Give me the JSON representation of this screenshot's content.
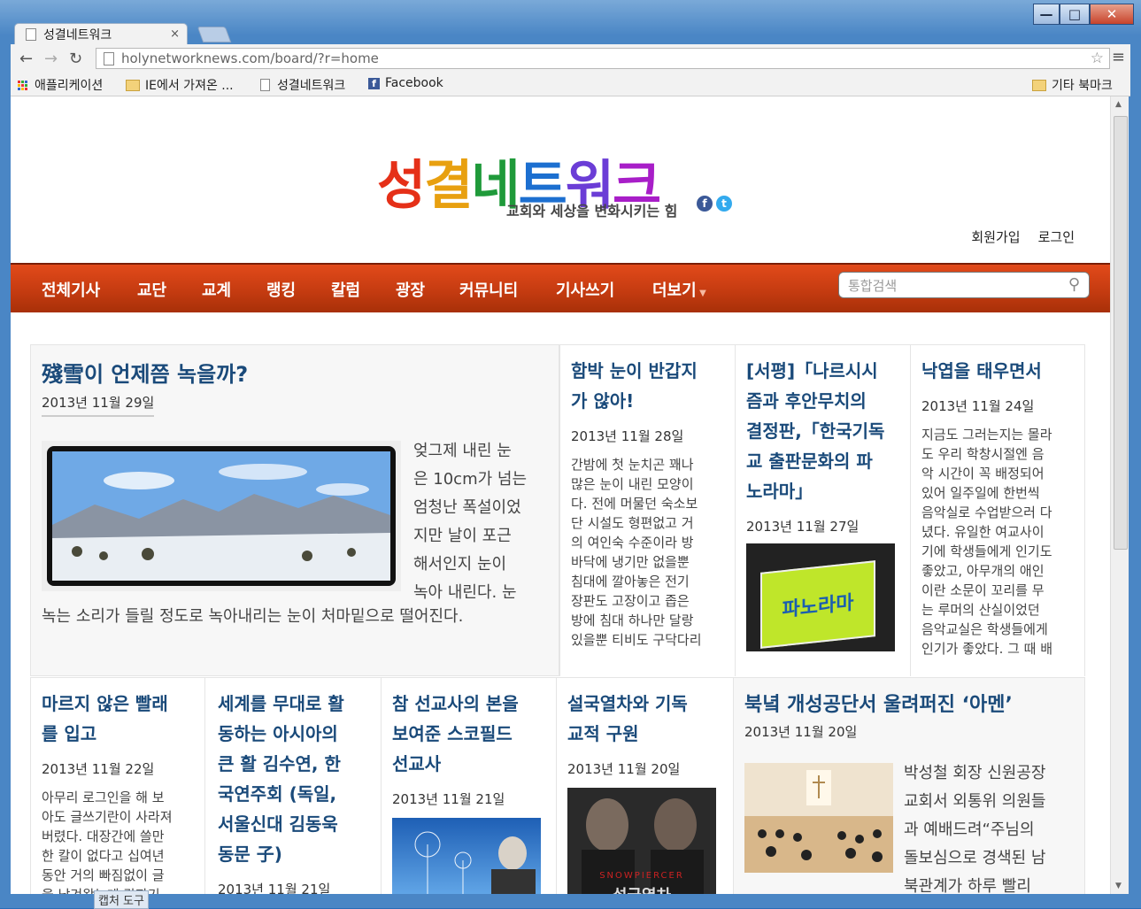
{
  "browser": {
    "tab_title": "성결네트워크",
    "tab_close": "×",
    "url": "holynetworknews.com/board/?r=home",
    "bookmarks": [
      "애플리케이션",
      "IE에서 가져온 ...",
      "성결네트워크",
      "Facebook"
    ],
    "other_bookmarks": "기타 북마크",
    "window_controls": {
      "minimize": "—",
      "maximize": "□",
      "close": "✕"
    }
  },
  "site": {
    "logo_chars": [
      "성",
      "결",
      "네",
      "트",
      "워",
      "크"
    ],
    "tagline": "교회와 세상을 변화시키는 힘",
    "top_links": [
      "회원가입",
      "로그인"
    ],
    "nav": [
      "전체기사",
      "교단",
      "교계",
      "랭킹",
      "칼럼",
      "광장",
      "커뮤니티",
      "기사쓰기",
      "더보기"
    ],
    "search_placeholder": "통합검색"
  },
  "colors": {
    "nav_bg": "#c23a10",
    "title_blue": "#1a4a7a",
    "logo": [
      "#e53018",
      "#e8a010",
      "#1f9a3a",
      "#1c6fd0",
      "#6b3dd6",
      "#a81ec8"
    ]
  },
  "articles": {
    "featured": {
      "title": "殘雪이 언제쯤 녹을까?",
      "date": "2013년 11월 29일",
      "text_beside": [
        "엊그제 내린 눈",
        "은 10cm가 넘는",
        "엄청난 폭설이었",
        "지만 날이 포근",
        "해서인지 눈이",
        "녹아 내린다. 눈"
      ],
      "text_below": "녹는 소리가 들릴 정도로 녹아내리는 눈이 처마밑으로 떨어진다."
    },
    "a2": {
      "title": [
        "함박 눈이 반갑지",
        "가 않아!"
      ],
      "date": "2013년 11월 28일",
      "text": [
        "간밤에 첫 눈치곤 꽤나",
        "많은 눈이 내린 모양이",
        "다. 전에 머물던 숙소보",
        "단 시설도 형편없고 거",
        "의 여인숙 수준이라 방",
        "바닥에 냉기만 없을뿐",
        "침대에 깔아놓은 전기",
        "장판도 고장이고 좁은",
        "방에 침대 하나만 달랑",
        "있을뿐 티비도 구닥다리"
      ]
    },
    "a3": {
      "title": [
        "[서평]「나르시시",
        "즘과 후안무치의",
        "결정판,「한국기독",
        "교 출판문화의 파",
        "노라마」"
      ],
      "date": "2013년 11월 27일",
      "book_text": "파노라마"
    },
    "a4": {
      "title": [
        "낙엽을 태우면서"
      ],
      "date": "2013년 11월 24일",
      "text": [
        "지금도 그러는지는 몰라",
        "도 우리 학창시절엔 음",
        "악 시간이 꼭 배정되어",
        "있어 일주일에 한번씩",
        "음악실로 수업받으러 다",
        "녔다. 유일한 여교사이",
        "기에 학생들에게 인기도",
        "좋았고, 아무개의 애인",
        "이란 소문이 꼬리를 무",
        "는 루머의 산실이었던",
        "음악교실은 학생들에게",
        "인기가 좋았다. 그 때 배"
      ]
    },
    "a5": {
      "title": [
        "마르지 않은 빨래",
        "를 입고"
      ],
      "date": "2013년 11월 22일",
      "text": [
        "아무리 로그인을 해 보",
        "아도 글쓰기란이 사라져",
        "버렸다. 대장간에 쓸만",
        "한 칼이 없다고 십여년",
        "동안 거의 빠짐없이 글",
        "을 남겨왔는데 갑자기"
      ]
    },
    "a6": {
      "title": [
        "세계를 무대로 활",
        "동하는 아시아의",
        "큰 활 김수연, 한",
        "국연주회 (독일,",
        "서울신대 김동욱",
        "동문 子)"
      ],
      "date": "2013년 11월 21일"
    },
    "a7": {
      "title": [
        "참 선교사의 본을",
        "보여준 스코필드",
        "선교사"
      ],
      "date": "2013년 11월 21일"
    },
    "a8": {
      "title": [
        "설국열차와 기독",
        "교적 구원"
      ],
      "date": "2013년 11월 20일",
      "poster_text": "SNOWPIERCER",
      "poster_title": "설국열차"
    },
    "a9": {
      "title": "북녘 개성공단서 울려퍼진 ‘아멘’",
      "date": "2013년 11월 20일",
      "text": [
        "박성철 회장 신원공장",
        "교회서 외통위 의원들",
        "과 예배드려“주님의",
        "돌보심으로 경색된 남",
        "북관계가 하루 빨리"
      ]
    }
  },
  "taskbar": {
    "capture_tool": "캡처 도구"
  }
}
